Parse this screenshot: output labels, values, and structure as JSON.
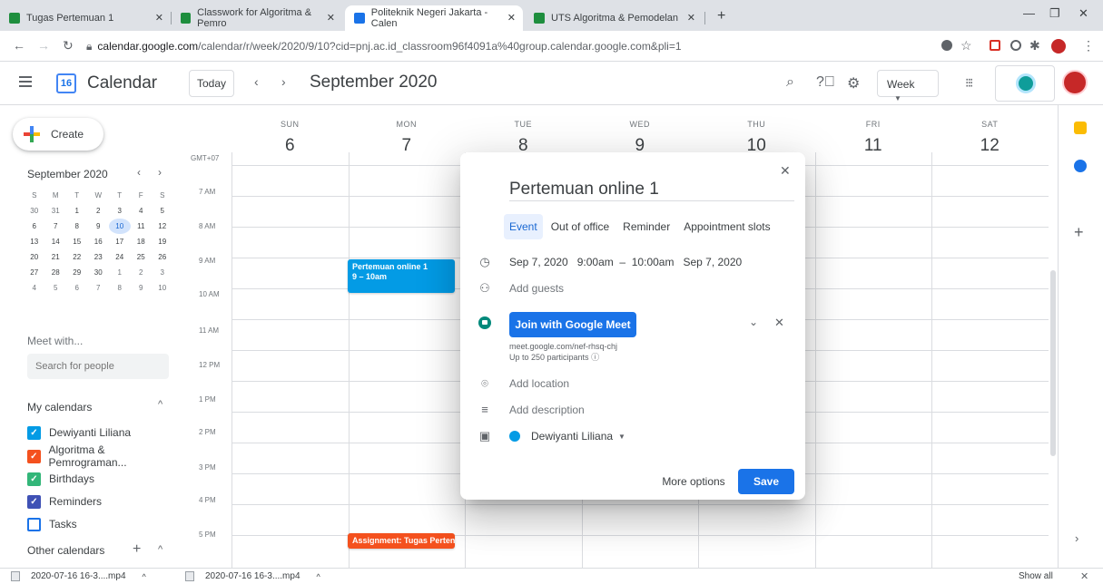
{
  "browser": {
    "tabs": [
      {
        "title": "Tugas Pertemuan 1",
        "active": false
      },
      {
        "title": "Classwork for Algoritma & Pemro",
        "active": false
      },
      {
        "title": "Politeknik Negeri Jakarta - Calen",
        "active": true
      },
      {
        "title": "UTS Algoritma & Pemodelan",
        "active": false
      }
    ],
    "url_host": "calendar.google.com",
    "url_path": "/calendar/r/week/2020/9/10?cid=pnj.ac.id_classroom96f4091a%40group.calendar.google.com&pli=1"
  },
  "header": {
    "logo_day": "16",
    "app_name": "Calendar",
    "today_label": "Today",
    "title": "September 2020",
    "view_select": "Week"
  },
  "sidebar": {
    "create_label": "Create",
    "mini_title": "September 2020",
    "mini_weekdays": [
      "S",
      "M",
      "T",
      "W",
      "T",
      "F",
      "S"
    ],
    "mini_weeks": [
      [
        "30",
        "31",
        "1",
        "2",
        "3",
        "4",
        "5"
      ],
      [
        "6",
        "7",
        "8",
        "9",
        "10",
        "11",
        "12"
      ],
      [
        "13",
        "14",
        "15",
        "16",
        "17",
        "18",
        "19"
      ],
      [
        "20",
        "21",
        "22",
        "23",
        "24",
        "25",
        "26"
      ],
      [
        "27",
        "28",
        "29",
        "30",
        "1",
        "2",
        "3"
      ],
      [
        "4",
        "5",
        "6",
        "7",
        "8",
        "9",
        "10"
      ]
    ],
    "meet_title": "Meet with...",
    "search_placeholder": "Search for people",
    "my_calendars_title": "My calendars",
    "calendars": [
      {
        "label": "Dewiyanti Liliana",
        "color": "#039be5",
        "checked": true
      },
      {
        "label": "Algoritma & Pemrograman...",
        "color": "#f4511e",
        "checked": true
      },
      {
        "label": "Birthdays",
        "color": "#33b679",
        "checked": true
      },
      {
        "label": "Reminders",
        "color": "#3f51b5",
        "checked": true
      },
      {
        "label": "Tasks",
        "color": "#1a73e8",
        "checked": false
      }
    ],
    "other_calendars_title": "Other calendars"
  },
  "week": {
    "timezone": "GMT+07",
    "days": [
      {
        "name": "SUN",
        "date": "6"
      },
      {
        "name": "MON",
        "date": "7"
      },
      {
        "name": "TUE",
        "date": "8"
      },
      {
        "name": "WED",
        "date": "9"
      },
      {
        "name": "THU",
        "date": "10"
      },
      {
        "name": "FRI",
        "date": "11"
      },
      {
        "name": "SAT",
        "date": "12"
      }
    ],
    "hours": [
      "7 AM",
      "8 AM",
      "9 AM",
      "10 AM",
      "11 AM",
      "12 PM",
      "1 PM",
      "2 PM",
      "3 PM",
      "4 PM",
      "5 PM"
    ],
    "events": [
      {
        "title": "Pertemuan online 1",
        "time": "9 – 10am",
        "color": "#039be5"
      },
      {
        "title": "Assignment: Tugas Perten",
        "color": "#f4511e"
      }
    ]
  },
  "dialog": {
    "title": "Pertemuan online 1",
    "tabs": [
      "Event",
      "Out of office",
      "Reminder",
      "Appointment slots"
    ],
    "datetime": "Sep 7, 2020   9:00am  –  10:00am   Sep 7, 2020",
    "add_guests": "Add guests",
    "meet_button": "Join with Google Meet",
    "meet_url": "meet.google.com/nef-rhsq-chj",
    "meet_participants": "Up to 250 participants",
    "add_location": "Add location",
    "add_description": "Add description",
    "calendar_owner": "Dewiyanti Liliana",
    "more_options": "More options",
    "save": "Save"
  },
  "downloads": {
    "items": [
      "2020-07-16 16-3....mp4",
      "2020-07-16 16-3....mp4"
    ],
    "show_all": "Show all"
  }
}
